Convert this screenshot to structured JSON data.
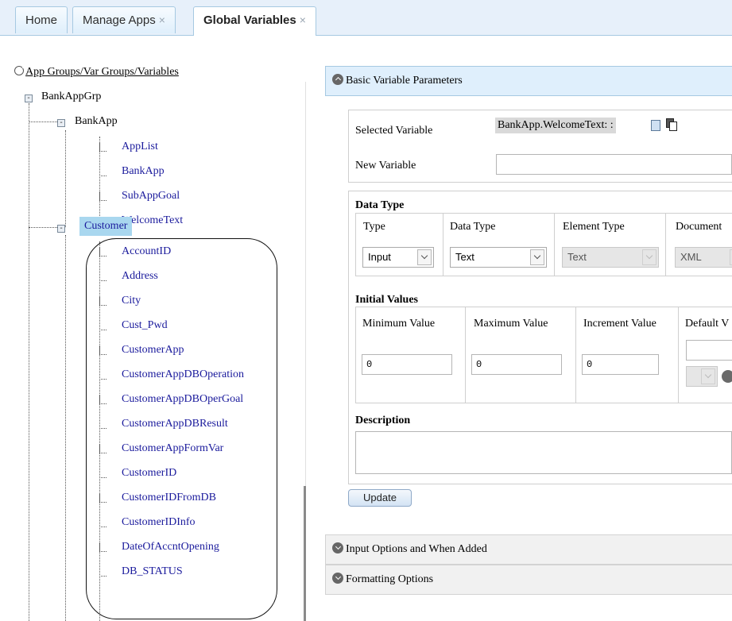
{
  "tabs": [
    {
      "label": "Home",
      "closable": false
    },
    {
      "label": "Manage Apps",
      "closable": true
    },
    {
      "label": "Global Variables",
      "closable": true,
      "active": true
    }
  ],
  "close_glyph": "×",
  "tree": {
    "root_label": "App Groups/Var Groups/Variables",
    "group": "BankAppGrp",
    "bankapp": {
      "label": "BankApp",
      "children": [
        "AppList",
        "BankApp",
        "SubAppGoal",
        "WelcomeText"
      ]
    },
    "customer": {
      "label": "Customer",
      "children": [
        "AccountID",
        "Address",
        "City",
        "Cust_Pwd",
        "CustomerApp",
        "CustomerAppDBOperation",
        "CustomerAppDBOperGoal",
        "CustomerAppDBResult",
        "CustomerAppFormVar",
        "CustomerID",
        "CustomerIDFromDB",
        "CustomerIDInfo",
        "DateOfAccntOpening",
        "DB_STATUS"
      ]
    }
  },
  "panel": {
    "basic_header": "Basic Variable Parameters",
    "selected_variable_label": "Selected Variable",
    "selected_variable_value": "BankApp.WelcomeText: :",
    "new_variable_label": "New Variable",
    "new_variable_value": "",
    "data_type": {
      "title": "Data Type",
      "columns": [
        "Type",
        "Data Type",
        "Element Type",
        "Document"
      ],
      "values": [
        "Input",
        "Text",
        "Text",
        "XML"
      ]
    },
    "initial_values": {
      "title": "Initial Values",
      "columns": [
        "Minimum Value",
        "Maximum Value",
        "Increment Value",
        "Default V"
      ],
      "values": [
        "0",
        "0",
        "0",
        ""
      ]
    },
    "description": {
      "title": "Description",
      "value": ""
    },
    "update_label": "Update",
    "input_options_header": "Input Options and When Added",
    "formatting_header": "Formatting Options"
  }
}
